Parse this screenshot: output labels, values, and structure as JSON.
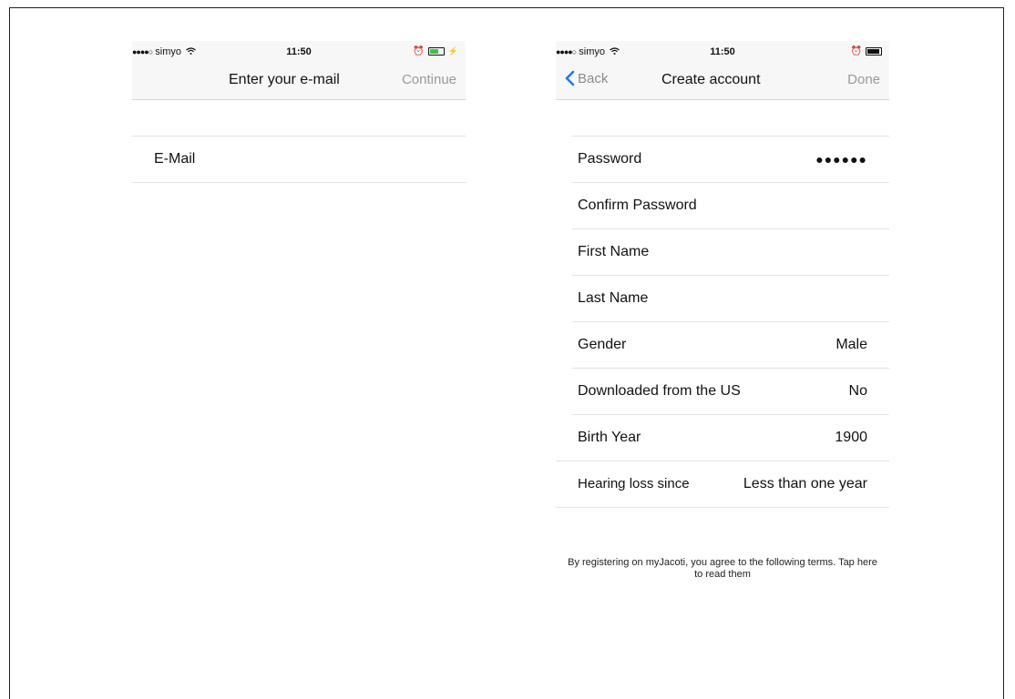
{
  "left_screen": {
    "status": {
      "carrier": "simyo",
      "signal_dots": "●●●●○",
      "time": "11:50",
      "battery_color": "#3cc43c"
    },
    "nav": {
      "title": "Enter your e-mail",
      "action": "Continue"
    },
    "fields": [
      {
        "label": "E-Mail"
      }
    ]
  },
  "right_screen": {
    "status": {
      "carrier": "simyo",
      "signal_dots": "●●●●○",
      "time": "11:50",
      "battery_color": "#111111"
    },
    "nav": {
      "back": "Back",
      "title": "Create account",
      "action": "Done"
    },
    "fields": [
      {
        "label": "Password",
        "value": "●●●●●●"
      },
      {
        "label": "Confirm Password",
        "value": ""
      },
      {
        "label": "First Name",
        "value": ""
      },
      {
        "label": "Last Name",
        "value": ""
      },
      {
        "label": "Gender",
        "value": "Male"
      },
      {
        "label": "Downloaded from the US",
        "value": "No"
      },
      {
        "label": "Birth Year",
        "value": "1900"
      },
      {
        "label": "Hearing loss since",
        "value": "Less than one year"
      }
    ],
    "terms": "By registering on myJacoti, you agree to the following terms. Tap here to read them"
  },
  "colors": {
    "accent_blue": "#1a7cf0",
    "nav_gray": "#9a9a9a"
  }
}
